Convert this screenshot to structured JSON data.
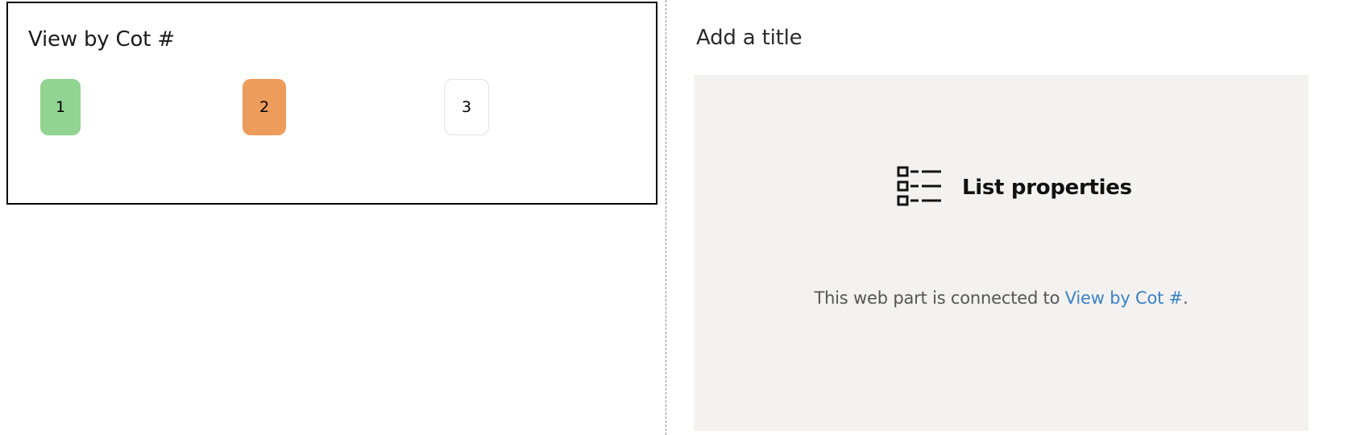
{
  "left_webpart": {
    "title": "View by Cot #",
    "cots": [
      {
        "label": "1",
        "color": "#92d492"
      },
      {
        "label": "2",
        "color": "#ee9c5b"
      },
      {
        "label": "3",
        "color": "#ffffff"
      }
    ]
  },
  "right_webpart": {
    "title": "Add a title",
    "placeholder": {
      "icon": "list-properties-icon",
      "label": "List properties",
      "description_prefix": "This web part is connected to ",
      "connected_link": "View by Cot #",
      "description_suffix": "."
    }
  },
  "colors": {
    "panel_background": "#f3f2f1",
    "link": "#3b82c4"
  }
}
